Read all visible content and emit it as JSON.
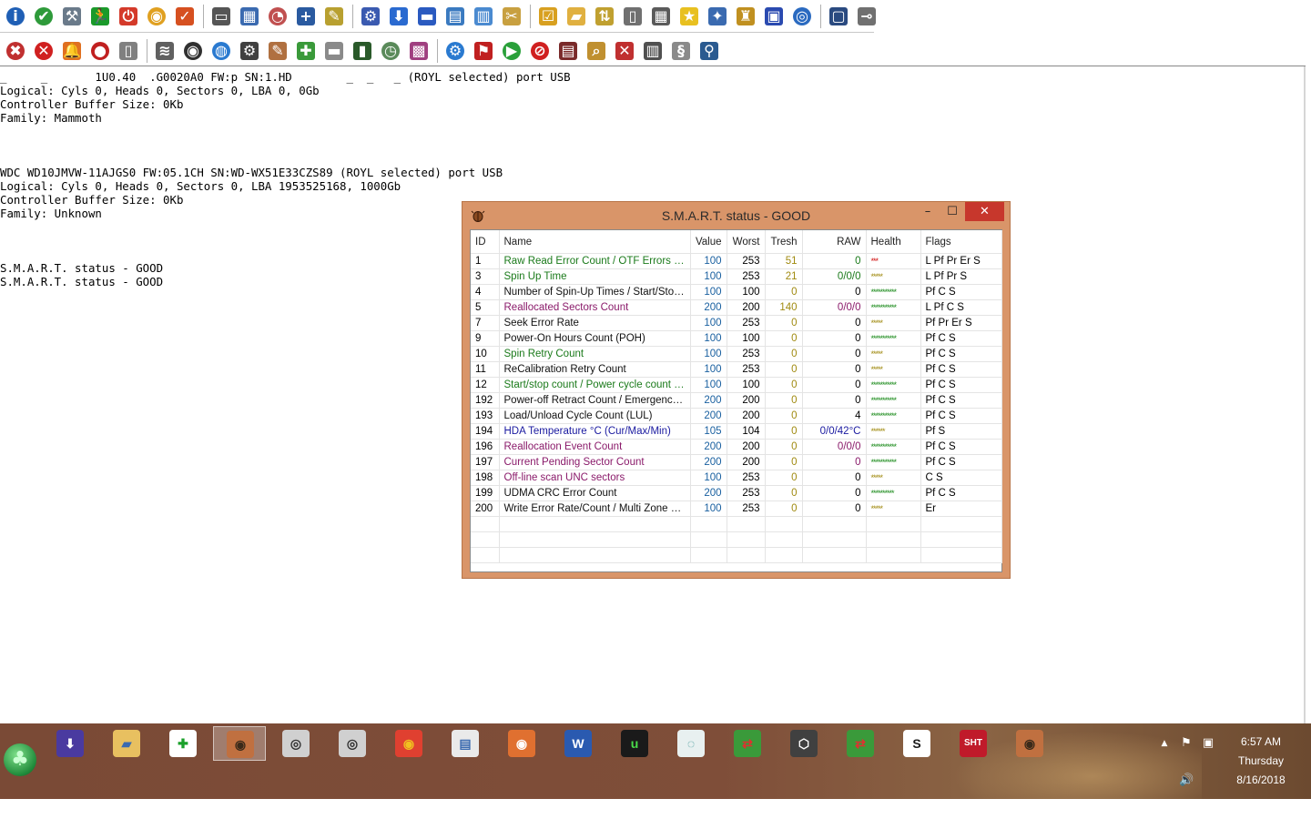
{
  "toolbar1": {
    "buttons": [
      {
        "name": "info-icon",
        "color": "#1f5fb5",
        "glyph": "i",
        "shape": "circle"
      },
      {
        "name": "shield-check-icon",
        "color": "#2e9a3a",
        "glyph": "✔",
        "shape": "circle"
      },
      {
        "name": "hammer-icon",
        "color": "#6a7a8a",
        "glyph": "⚒",
        "shape": "square"
      },
      {
        "name": "running-man-icon",
        "color": "#1a9a2a",
        "glyph": "🏃",
        "shape": "square"
      },
      {
        "name": "power-icon",
        "color": "#d43a2a",
        "glyph": "⏻",
        "shape": "square"
      },
      {
        "name": "colorful-disk-icon",
        "color": "#e0a020",
        "glyph": "◉",
        "shape": "circle"
      },
      {
        "name": "checkmark-icon",
        "color": "#d65020",
        "glyph": "✓",
        "shape": "square"
      },
      {
        "name": "memory-chip-icon",
        "color": "#555555",
        "glyph": "▭",
        "shape": "square"
      },
      {
        "name": "window-tools-icon",
        "color": "#3a6ab0",
        "glyph": "▦",
        "shape": "square"
      },
      {
        "name": "gauge-icon",
        "color": "#c05050",
        "glyph": "◔",
        "shape": "circle"
      },
      {
        "name": "tree-add-icon",
        "color": "#2a5aa0",
        "glyph": "+",
        "shape": "square"
      },
      {
        "name": "edit-note-icon",
        "color": "#b8a030",
        "glyph": "✎",
        "shape": "square"
      },
      {
        "name": "tools-icon",
        "color": "#3a5ab0",
        "glyph": "⚙",
        "shape": "square"
      },
      {
        "name": "download-icon",
        "color": "#2a6ad0",
        "glyph": "⬇",
        "shape": "square"
      },
      {
        "name": "monitor-icon",
        "color": "#2a5ac0",
        "glyph": "▬",
        "shape": "square"
      },
      {
        "name": "document-icon",
        "color": "#3a7ac0",
        "glyph": "▤",
        "shape": "square"
      },
      {
        "name": "settings-panel-icon",
        "color": "#4a8ad0",
        "glyph": "▥",
        "shape": "square"
      },
      {
        "name": "tools-pliers-icon",
        "color": "#c8a040",
        "glyph": "✂",
        "shape": "square"
      },
      {
        "name": "checklist-icon",
        "color": "#d8a020",
        "glyph": "☑",
        "shape": "square"
      },
      {
        "name": "folder-icon",
        "color": "#e0b040",
        "glyph": "▰",
        "shape": "square"
      },
      {
        "name": "arrows-icon",
        "color": "#c0a030",
        "glyph": "⇅",
        "shape": "square"
      },
      {
        "name": "clipboard-icon",
        "color": "#707070",
        "glyph": "▯",
        "shape": "square"
      },
      {
        "name": "table-icon",
        "color": "#5a5a5a",
        "glyph": "▦",
        "shape": "square"
      },
      {
        "name": "star-icon",
        "color": "#e8c020",
        "glyph": "★",
        "shape": "square"
      },
      {
        "name": "magic-wand-icon",
        "color": "#3a6ab0",
        "glyph": "✦",
        "shape": "square"
      },
      {
        "name": "hydrant-icon",
        "color": "#c09020",
        "glyph": "♜",
        "shape": "square"
      },
      {
        "name": "chart-monitor-icon",
        "color": "#2a4ab0",
        "glyph": "▣",
        "shape": "square"
      },
      {
        "name": "network-globe-icon",
        "color": "#2a6ac0",
        "glyph": "◎",
        "shape": "circle"
      },
      {
        "name": "panel-window-icon",
        "color": "#2a4a80",
        "glyph": "▢",
        "shape": "square"
      },
      {
        "name": "pin-icon",
        "color": "#707070",
        "glyph": "⊸",
        "shape": "square"
      }
    ]
  },
  "toolbar2": {
    "buttons": [
      {
        "name": "shield-x-icon",
        "color": "#c03030",
        "glyph": "✖",
        "shape": "circle"
      },
      {
        "name": "stop-x-icon",
        "color": "#d02020",
        "glyph": "✕",
        "shape": "circle"
      },
      {
        "name": "bell-icon",
        "color": "#e07020",
        "glyph": "🔔",
        "shape": "square"
      },
      {
        "name": "apple-icon",
        "color": "#c02020",
        "glyph": "●",
        "shape": "circle"
      },
      {
        "name": "page-arrow-icon",
        "color": "#808080",
        "glyph": "▯",
        "shape": "square"
      },
      {
        "name": "tornado-icon",
        "color": "#606060",
        "glyph": "≋",
        "shape": "square"
      },
      {
        "name": "disk-platter-icon",
        "color": "#303030",
        "glyph": "◉",
        "shape": "circle"
      },
      {
        "name": "globe-icon",
        "color": "#2a7ad0",
        "glyph": "◍",
        "shape": "circle"
      },
      {
        "name": "gears-icon",
        "color": "#404040",
        "glyph": "⚙",
        "shape": "square"
      },
      {
        "name": "pencil-icon",
        "color": "#b07040",
        "glyph": "✎",
        "shape": "square"
      },
      {
        "name": "network-add-icon",
        "color": "#3a9a3a",
        "glyph": "✚",
        "shape": "square"
      },
      {
        "name": "network-remove-icon",
        "color": "#8a8a8a",
        "glyph": "▬",
        "shape": "square"
      },
      {
        "name": "terminal-icon",
        "color": "#2a5a2a",
        "glyph": "▮",
        "shape": "square"
      },
      {
        "name": "clock-arrow-icon",
        "color": "#5a8a5a",
        "glyph": "◷",
        "shape": "circle"
      },
      {
        "name": "package-icon",
        "color": "#a04080",
        "glyph": "▩",
        "shape": "square"
      },
      {
        "name": "cogwheel-blue-icon",
        "color": "#2a7ad0",
        "glyph": "⚙",
        "shape": "circle"
      },
      {
        "name": "run-red-icon",
        "color": "#c02020",
        "glyph": "⚑",
        "shape": "square"
      },
      {
        "name": "play-icon",
        "color": "#2aa03a",
        "glyph": "▶",
        "shape": "circle"
      },
      {
        "name": "no-entry-icon",
        "color": "#d02020",
        "glyph": "⊘",
        "shape": "circle"
      },
      {
        "name": "list-form-icon",
        "color": "#7a2a2a",
        "glyph": "▤",
        "shape": "square"
      },
      {
        "name": "search-doc-icon",
        "color": "#c09030",
        "glyph": "⌕",
        "shape": "square"
      },
      {
        "name": "close-box-icon",
        "color": "#c03030",
        "glyph": "✕",
        "shape": "square"
      },
      {
        "name": "report-icon",
        "color": "#505050",
        "glyph": "▥",
        "shape": "square"
      },
      {
        "name": "scroll-icon",
        "color": "#8a8a8a",
        "glyph": "§",
        "shape": "square"
      },
      {
        "name": "magnifier-icon",
        "color": "#2a5a90",
        "glyph": "⚲",
        "shape": "square"
      }
    ]
  },
  "console": {
    "lines": [
      "_     _       1U0.40  .G0020A0 FW:p SN:1.HD        _  _   _ (ROYL selected) port USB",
      "Logical: Cyls 0, Heads 0, Sectors 0, LBA 0, 0Gb",
      "Controller Buffer Size: 0Kb",
      "Family: Mammoth",
      "",
      "",
      "",
      "WDC WD10JMVW-11AJGS0 FW:05.1CH SN:WD-WX51E33CZS89 (ROYL selected) port USB",
      "Logical: Cyls 0, Heads 0, Sectors 0, LBA 1953525168, 1000Gb",
      "Controller Buffer Size: 0Kb",
      "Family: Unknown",
      "",
      "",
      "",
      "S.M.A.R.T. status - GOOD",
      "S.M.A.R.T. status - GOOD"
    ]
  },
  "smart_window": {
    "title": "S.M.A.R.T. status - GOOD",
    "minimize": "–",
    "maximize": "☐",
    "close": "✕",
    "columns": [
      "ID",
      "Name",
      "Value",
      "Worst",
      "Tresh",
      "RAW",
      "Health",
      "Flags"
    ],
    "rows": [
      {
        "id": "1",
        "name": "Raw Read Error Count / OTF Errors (M...",
        "value": "100",
        "worst": "253",
        "tresh": "51",
        "raw": "0",
        "health": "***",
        "flags": "L  Pf Pr Er S",
        "name_color": "#1a7a1a",
        "health_color": "#d01010"
      },
      {
        "id": "3",
        "name": "Spin Up Time",
        "value": "100",
        "worst": "253",
        "tresh": "21",
        "raw": "0/0/0",
        "health": "*****",
        "flags": "L  Pf Pr S",
        "name_color": "#1a7a1a",
        "health_color": "#a08a10"
      },
      {
        "id": "4",
        "name": "Number of Spin-Up Times / Start/Stop ...",
        "value": "100",
        "worst": "100",
        "tresh": "0",
        "raw": "0",
        "health": "***********",
        "flags": "Pf C  S",
        "name_color": "#111111",
        "health_color": "#1a8a1a"
      },
      {
        "id": "5",
        "name": "Reallocated Sectors Count",
        "value": "200",
        "worst": "200",
        "tresh": "140",
        "raw": "0/0/0",
        "health": "***********",
        "flags": "L  Pf C  S",
        "name_color": "#8a1a6a",
        "health_color": "#1a8a1a"
      },
      {
        "id": "7",
        "name": "Seek Error Rate",
        "value": "100",
        "worst": "253",
        "tresh": "0",
        "raw": "0",
        "health": "*****",
        "flags": "Pf Pr Er S",
        "name_color": "#111111",
        "health_color": "#a08a10"
      },
      {
        "id": "9",
        "name": "Power-On Hours Count (POH)",
        "value": "100",
        "worst": "100",
        "tresh": "0",
        "raw": "0",
        "health": "***********",
        "flags": "Pf C  S",
        "name_color": "#111111",
        "health_color": "#1a8a1a"
      },
      {
        "id": "10",
        "name": "Spin Retry Count",
        "value": "100",
        "worst": "253",
        "tresh": "0",
        "raw": "0",
        "health": "*****",
        "flags": "Pf C  S",
        "name_color": "#1a7a1a",
        "health_color": "#a08a10"
      },
      {
        "id": "11",
        "name": "ReCalibration Retry Count",
        "value": "100",
        "worst": "253",
        "tresh": "0",
        "raw": "0",
        "health": "*****",
        "flags": "Pf C  S",
        "name_color": "#111111",
        "health_color": "#a08a10"
      },
      {
        "id": "12",
        "name": "Start/stop count / Power cycle count (I...",
        "value": "100",
        "worst": "100",
        "tresh": "0",
        "raw": "0",
        "health": "***********",
        "flags": "Pf C  S",
        "name_color": "#1a7a1a",
        "health_color": "#1a8a1a"
      },
      {
        "id": "192",
        "name": "Power-off Retract Count / Emergency R...",
        "value": "200",
        "worst": "200",
        "tresh": "0",
        "raw": "0",
        "health": "***********",
        "flags": "Pf C  S",
        "name_color": "#111111",
        "health_color": "#1a8a1a"
      },
      {
        "id": "193",
        "name": "Load/Unload Cycle Count (LUL)",
        "value": "200",
        "worst": "200",
        "tresh": "0",
        "raw": "4",
        "health": "***********",
        "flags": "Pf C  S",
        "name_color": "#111111",
        "health_color": "#1a8a1a"
      },
      {
        "id": "194",
        "name": "HDA Temperature °C (Cur/Max/Min)",
        "value": "105",
        "worst": "104",
        "tresh": "0",
        "raw": "0/0/42°C",
        "health": "******",
        "flags": "Pf S",
        "name_color": "#1a1aa0",
        "health_color": "#a08a10"
      },
      {
        "id": "196",
        "name": "Reallocation Event Count",
        "value": "200",
        "worst": "200",
        "tresh": "0",
        "raw": "0/0/0",
        "health": "***********",
        "flags": "Pf C  S",
        "name_color": "#8a1a6a",
        "health_color": "#1a8a1a"
      },
      {
        "id": "197",
        "name": "Current Pending Sector Count",
        "value": "200",
        "worst": "200",
        "tresh": "0",
        "raw": "0",
        "health": "***********",
        "flags": "Pf C  S",
        "name_color": "#8a1a6a",
        "health_color": "#1a8a1a"
      },
      {
        "id": "198",
        "name": "Off-line scan UNC sectors",
        "value": "100",
        "worst": "253",
        "tresh": "0",
        "raw": "0",
        "health": "*****",
        "flags": "C  S",
        "name_color": "#8a1a6a",
        "health_color": "#a08a10"
      },
      {
        "id": "199",
        "name": "UDMA CRC Error Count",
        "value": "200",
        "worst": "253",
        "tresh": "0",
        "raw": "0",
        "health": "**********",
        "flags": "Pf C  S",
        "name_color": "#111111",
        "health_color": "#1a8a1a"
      },
      {
        "id": "200",
        "name": "Write Error Rate/Count / Multi Zone Err...",
        "value": "100",
        "worst": "253",
        "tresh": "0",
        "raw": "0",
        "health": "*****",
        "flags": "Er",
        "name_color": "#111111",
        "health_color": "#a08a10"
      }
    ],
    "colors": {
      "value": "#1a60a0",
      "tresh": "#a08a10",
      "raw_mismatch": "#1a7a1a",
      "window_frame": "#d99569",
      "close_button": "#c7372c"
    }
  },
  "taskbar": {
    "apps": [
      {
        "name": "download-manager-icon",
        "color": "#4a3aa0",
        "glyph": "⬇",
        "fg": "#ffffff",
        "active": false
      },
      {
        "name": "file-explorer-icon",
        "color": "#e8c060",
        "glyph": "▰",
        "fg": "#3a6ab0",
        "active": false
      },
      {
        "name": "green-cross-icon",
        "color": "#ffffff",
        "glyph": "✚",
        "fg": "#1aa02a",
        "active": false
      },
      {
        "name": "hdd-tool-icon",
        "color": "#c07040",
        "glyph": "◉",
        "fg": "#3a2a1a",
        "active": true
      },
      {
        "name": "hdd-utility-icon",
        "color": "#d0d0d0",
        "glyph": "◎",
        "fg": "#303030",
        "active": false
      },
      {
        "name": "hdd-utility-2-icon",
        "color": "#d0d0d0",
        "glyph": "◎",
        "fg": "#303030",
        "active": false
      },
      {
        "name": "chrome-icon",
        "color": "#e04030",
        "glyph": "◉",
        "fg": "#f0c020",
        "active": false
      },
      {
        "name": "notepad-icon",
        "color": "#eaeaea",
        "glyph": "▤",
        "fg": "#3a6ab0",
        "active": false
      },
      {
        "name": "eye-app-icon",
        "color": "#e07030",
        "glyph": "◉",
        "fg": "#ffffff",
        "active": false
      },
      {
        "name": "word-icon",
        "color": "#2a5ab0",
        "glyph": "W",
        "fg": "#ffffff",
        "active": false
      },
      {
        "name": "utorrent-icon",
        "color": "#1a1a1a",
        "glyph": "u",
        "fg": "#4adc4a",
        "active": false
      },
      {
        "name": "disk-scan-icon",
        "color": "#e8f0f0",
        "glyph": "◌",
        "fg": "#2a8a8a",
        "active": false
      },
      {
        "name": "network-plug-icon",
        "color": "#3a9a3a",
        "glyph": "⇄",
        "fg": "#e03030",
        "active": false
      },
      {
        "name": "drive-bay-icon",
        "color": "#404040",
        "glyph": "⬡",
        "fg": "#ffffff",
        "active": false
      },
      {
        "name": "network-plug-2-icon",
        "color": "#3a9a3a",
        "glyph": "⇄",
        "fg": "#e03030",
        "active": false
      },
      {
        "name": "seagate-icon",
        "color": "#ffffff",
        "glyph": "S",
        "fg": "#1a1a1a",
        "active": false
      },
      {
        "name": "sht-utilities-icon",
        "color": "#c01a2a",
        "glyph": "SHT",
        "fg": "#ffffff",
        "active": false
      },
      {
        "name": "hdd-tool-2-icon",
        "color": "#c07040",
        "glyph": "◉",
        "fg": "#3a2a1a",
        "active": false
      }
    ],
    "tray": {
      "show_hidden": "▲",
      "flag": "⚑",
      "network": "▣",
      "volume": "🔊"
    },
    "clock": {
      "time": "6:57 AM",
      "day": "Thursday",
      "date": "8/16/2018"
    }
  }
}
